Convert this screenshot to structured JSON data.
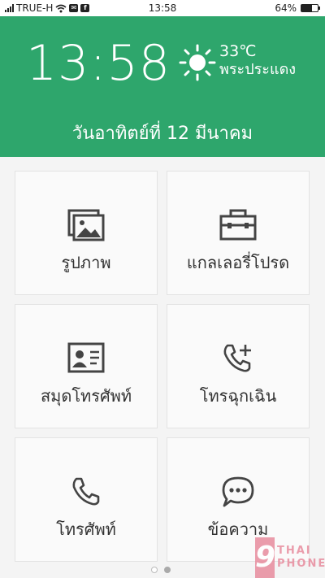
{
  "status_bar": {
    "carrier": "TRUE-H",
    "time": "13:58",
    "battery_percent": "64%",
    "battery_level": 0.64,
    "icons": [
      "signal-icon",
      "wifi-icon",
      "email-icon",
      "facebook-icon",
      "battery-icon"
    ]
  },
  "header": {
    "clock": "13:58",
    "temperature": "33℃",
    "location": "พระประแดง",
    "date": "วันอาทิตย์ที่ 12 มีนาคม",
    "weather_icon": "sun-icon",
    "background_color": "#2ea66c"
  },
  "tiles": [
    {
      "label": "รูปภาพ",
      "icon": "photos-icon"
    },
    {
      "label": "แกลเลอรี่โปรด",
      "icon": "toolbox-icon"
    },
    {
      "label": "สมุดโทรศัพท์",
      "icon": "contact-card-icon"
    },
    {
      "label": "โทรฉุกเฉิน",
      "icon": "emergency-call-icon"
    },
    {
      "label": "โทรศัพท์",
      "icon": "phone-icon"
    },
    {
      "label": "ข้อความ",
      "icon": "message-icon"
    }
  ],
  "pager": {
    "pages": 2,
    "current": 2
  },
  "watermark": {
    "logo": "9",
    "line1": "THAI",
    "line2": "PHONE"
  }
}
